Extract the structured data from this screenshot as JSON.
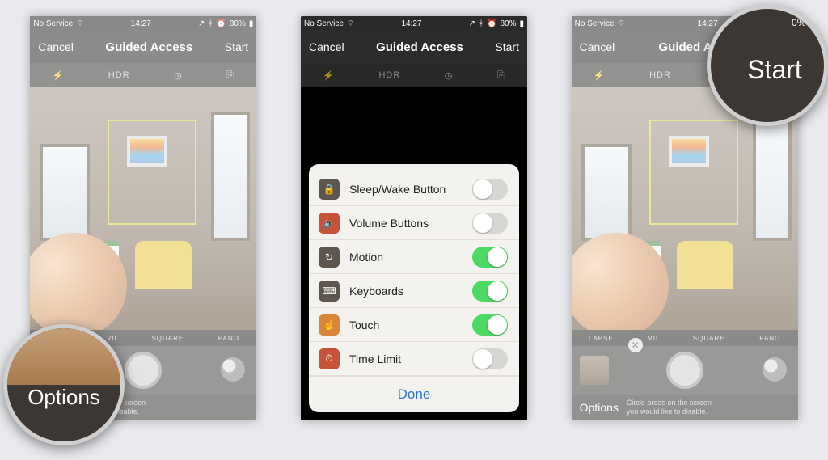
{
  "status": {
    "carrier": "No Service",
    "time": "14:27",
    "battery_pct": "80%"
  },
  "nav": {
    "cancel": "Cancel",
    "title": "Guided Access",
    "start": "Start"
  },
  "camera": {
    "icons": {
      "flash": "⚡",
      "hdr": "HDR",
      "timer": "◷",
      "switch": "⎘"
    },
    "modes": {
      "lapse": "LAPSE",
      "video": "VII",
      "square": "SQUARE",
      "pano": "PANO"
    }
  },
  "footer": {
    "options": "Options",
    "hint_line1": "Circle areas on the screen",
    "hint_line2": "you would like to disable.",
    "hint_partial1": "reas on the screen",
    "hint_partial2": "ld like to disable."
  },
  "options_sheet": {
    "rows": [
      {
        "label": "Sleep/Wake Button",
        "on": false,
        "icon": "🔒",
        "bg": "ic-dark"
      },
      {
        "label": "Volume Buttons",
        "on": false,
        "icon": "🔈",
        "bg": "ic-red"
      },
      {
        "label": "Motion",
        "on": true,
        "icon": "↻",
        "bg": "ic-dark"
      },
      {
        "label": "Keyboards",
        "on": true,
        "icon": "⌨",
        "bg": "ic-dark"
      },
      {
        "label": "Touch",
        "on": true,
        "icon": "☝",
        "bg": "ic-orange"
      },
      {
        "label": "Time Limit",
        "on": false,
        "icon": "⏱",
        "bg": "ic-red"
      }
    ],
    "done": "Done"
  },
  "zoom": {
    "options_label": "Options",
    "start_label": "Start",
    "start_batt": "0%"
  }
}
